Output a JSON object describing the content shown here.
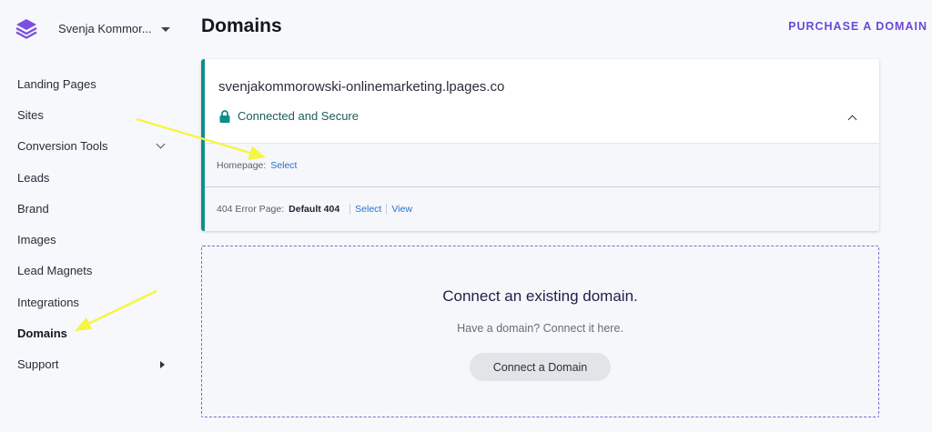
{
  "account": {
    "name": "Svenja Kommor...",
    "logo_icon": "layers-icon"
  },
  "sidebar": {
    "items": [
      {
        "label": "Landing Pages"
      },
      {
        "label": "Sites"
      },
      {
        "label": "Conversion Tools",
        "icon": "chevron-down-icon"
      },
      {
        "label": "Leads"
      },
      {
        "label": "Brand"
      },
      {
        "label": "Images"
      },
      {
        "label": "Lead Magnets"
      },
      {
        "label": "Integrations"
      },
      {
        "label": "Domains",
        "active": true
      },
      {
        "label": "Support",
        "icon": "caret-right-icon"
      }
    ]
  },
  "header": {
    "title": "Domains",
    "purchase_label": "PURCHASE A DOMAIN"
  },
  "domain_card": {
    "url": "svenjakommorowski-onlinemarketing.lpages.co",
    "status": "Connected and Secure",
    "homepage": {
      "label": "Homepage:",
      "action": "Select"
    },
    "error_page": {
      "label": "404 Error Page:",
      "value": "Default 404",
      "select": "Select",
      "view": "View"
    }
  },
  "connect": {
    "title": "Connect an existing domain.",
    "subtitle": "Have a domain? Connect it here.",
    "button": "Connect a Domain"
  },
  "colors": {
    "accent": "#6b49d6",
    "card_border": "#0e8f8c",
    "link": "#2a6fcf",
    "annotation_arrow": "#f5f542"
  }
}
